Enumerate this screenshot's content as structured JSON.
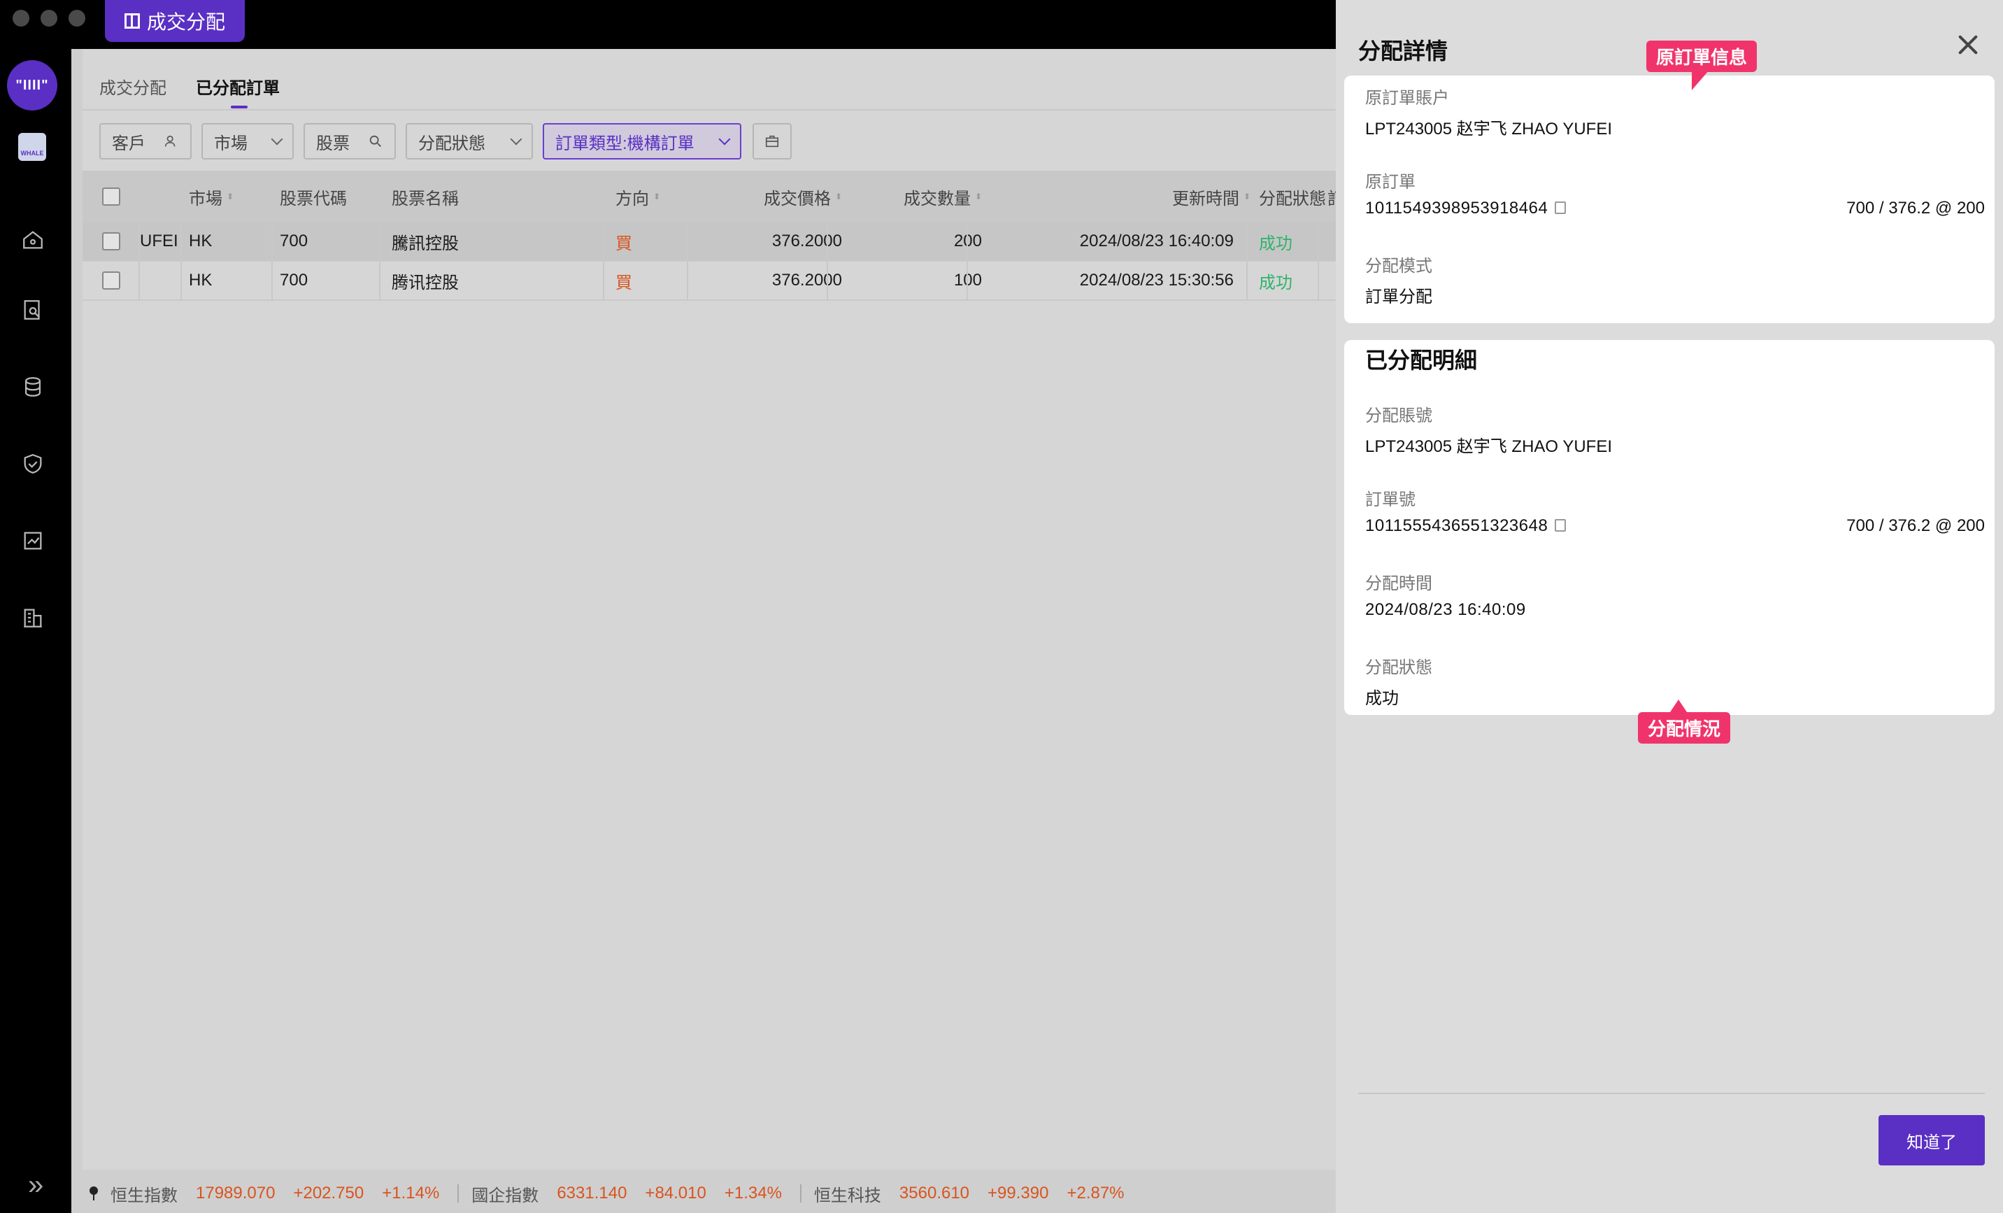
{
  "window": {
    "app_tab_label": "成交分配"
  },
  "sidebar": {
    "logo_text": "\"ΙΙΙΙ\"",
    "whale_text": "WHALE"
  },
  "tabs": [
    "成交分配",
    "已分配訂單"
  ],
  "filters": {
    "client": "客戶",
    "market": "市場",
    "stock": "股票",
    "status": "分配狀態",
    "order_type": "訂單類型:機構訂單"
  },
  "table": {
    "headers": [
      "市場",
      "股票代碼",
      "股票名稱",
      "方向",
      "成交價格",
      "成交數量",
      "更新時間",
      "分配狀態",
      "訂"
    ],
    "rows": [
      {
        "client": "UFEI",
        "market": "HK",
        "code": "700",
        "name": "騰訊控股",
        "side": "買",
        "price": "376.2000",
        "qty": "200",
        "time": "2024/08/23 16:40:09",
        "status": "成功"
      },
      {
        "client": "",
        "market": "HK",
        "code": "700",
        "name": "腾讯控股",
        "side": "買",
        "price": "376.2000",
        "qty": "100",
        "time": "2024/08/23 15:30:56",
        "status": "成功"
      }
    ]
  },
  "ticker": [
    {
      "name": "恒生指數",
      "price": "17989.070",
      "change": "+202.750",
      "pct": "+1.14%"
    },
    {
      "name": "國企指數",
      "price": "6331.140",
      "change": "+84.010",
      "pct": "+1.34%"
    },
    {
      "name": "恒生科技",
      "price": "3560.610",
      "change": "+99.390",
      "pct": "+2.87%"
    }
  ],
  "drawer": {
    "title": "分配詳情",
    "original": {
      "account_label": "原訂單賬户",
      "account_value": "LPT243005 赵宇飞 ZHAO YUFEI",
      "order_label": "原訂單",
      "order_value": "1011549398953918464",
      "order_detail": "700 / 376.2 @ 200",
      "mode_label": "分配模式",
      "mode_value": "訂單分配"
    },
    "allocated": {
      "title": "已分配明細",
      "account_label": "分配賬號",
      "account_value": "LPT243005 赵宇飞 ZHAO YUFEI",
      "order_label": "訂單號",
      "order_value": "1011555436551323648",
      "order_detail": "700 / 376.2 @ 200",
      "time_label": "分配時間",
      "time_value": "2024/08/23 16:40:09",
      "status_label": "分配狀態",
      "status_value": "成功"
    },
    "callout_original": "原訂單信息",
    "callout_allocation": "分配情況",
    "confirm_button": "知道了"
  },
  "colors": {
    "accent": "#5a2fc4",
    "callout": "#f0346b",
    "success": "#2fb36b",
    "buy": "#d9541e"
  }
}
